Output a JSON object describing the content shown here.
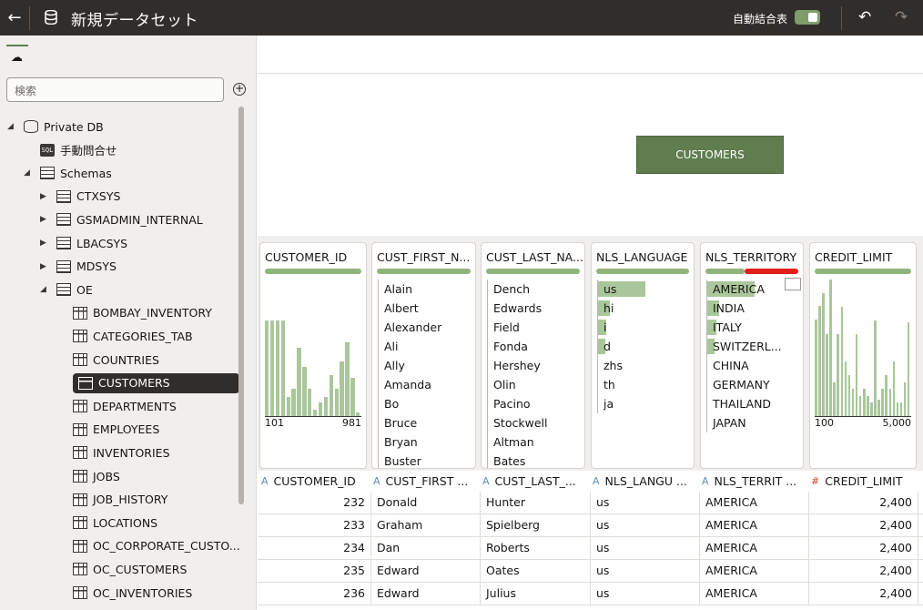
{
  "header": {
    "title": "新規データセット",
    "auto_join_label": "自動結合表",
    "auto_join_on": true
  },
  "sidebar": {
    "search_placeholder": "検索",
    "tree": [
      {
        "label": "Private DB",
        "type": "db",
        "level": 0,
        "expanded": true
      },
      {
        "label": "手動問合せ",
        "type": "sql",
        "level": 1
      },
      {
        "label": "Schemas",
        "type": "schema",
        "level": 1,
        "expanded": true
      },
      {
        "label": "CTXSYS",
        "type": "schema",
        "level": 2,
        "expanded": false
      },
      {
        "label": "GSMADMIN_INTERNAL",
        "type": "schema",
        "level": 2,
        "expanded": false
      },
      {
        "label": "LBACSYS",
        "type": "schema",
        "level": 2,
        "expanded": false
      },
      {
        "label": "MDSYS",
        "type": "schema",
        "level": 2,
        "expanded": false
      },
      {
        "label": "OE",
        "type": "schema",
        "level": 2,
        "expanded": true
      },
      {
        "label": "BOMBAY_INVENTORY",
        "type": "view",
        "level": 3
      },
      {
        "label": "CATEGORIES_TAB",
        "type": "table",
        "level": 3
      },
      {
        "label": "COUNTRIES",
        "type": "view",
        "level": 3
      },
      {
        "label": "CUSTOMERS",
        "type": "table",
        "level": 3,
        "selected": true
      },
      {
        "label": "DEPARTMENTS",
        "type": "view",
        "level": 3
      },
      {
        "label": "EMPLOYEES",
        "type": "view",
        "level": 3
      },
      {
        "label": "INVENTORIES",
        "type": "table",
        "level": 3
      },
      {
        "label": "JOBS",
        "type": "view",
        "level": 3
      },
      {
        "label": "JOB_HISTORY",
        "type": "view",
        "level": 3
      },
      {
        "label": "LOCATIONS",
        "type": "view",
        "level": 3
      },
      {
        "label": "OC_CORPORATE_CUSTO...",
        "type": "view",
        "level": 3
      },
      {
        "label": "OC_CUSTOMERS",
        "type": "view",
        "level": 3
      },
      {
        "label": "OC_INVENTORIES",
        "type": "view",
        "level": 3
      }
    ]
  },
  "diagram": {
    "entity_label": "CUSTOMERS"
  },
  "profile_cards": [
    {
      "title": "CUSTOMER_ID",
      "kind": "histogram",
      "bars": [
        0.7,
        0.7,
        0.7,
        0.7,
        0.14,
        0.2,
        0.5,
        0.36,
        0.2,
        0.05,
        0.1,
        0.14,
        0.3,
        0.2,
        0.4,
        0.54,
        0.28,
        0.03
      ],
      "min_label": "101",
      "max_label": "981",
      "quality": 1.0
    },
    {
      "title": "CUST_FIRST_N...",
      "kind": "list",
      "values": [
        "Alain",
        "Albert",
        "Alexander",
        "Ali",
        "Ally",
        "Amanda",
        "Bo",
        "Bruce",
        "Bryan",
        "Buster"
      ],
      "freq": [
        0,
        0,
        0,
        0,
        0,
        0,
        0,
        0,
        0,
        0
      ],
      "quality": 1.0
    },
    {
      "title": "CUST_LAST_NA...",
      "kind": "list",
      "values": [
        "Dench",
        "Edwards",
        "Field",
        "Fonda",
        "Hershey",
        "Olin",
        "Pacino",
        "Stockwell",
        "Altman",
        "Bates"
      ],
      "freq": [
        0,
        0,
        0,
        0,
        0,
        0,
        0,
        0,
        0,
        0
      ],
      "quality": 1.0
    },
    {
      "title": "NLS_LANGUAGE",
      "kind": "list",
      "values": [
        "us",
        "hi",
        "i",
        "d",
        "zhs",
        "th",
        "ja"
      ],
      "freq": [
        1.0,
        0.25,
        0.18,
        0.16,
        0,
        0,
        0
      ],
      "quality": 1.0
    },
    {
      "title": "NLS_TERRITORY",
      "kind": "list",
      "values": [
        "AMERICA",
        "INDIA",
        "ITALY",
        "SWITZERL...",
        "CHINA",
        "GERMANY",
        "THAILAND",
        "JAPAN"
      ],
      "freq": [
        1.0,
        0.25,
        0.2,
        0.15,
        0,
        0,
        0,
        0
      ],
      "quality": 0.42
    },
    {
      "title": "CREDIT_LIMIT",
      "kind": "histogram",
      "bars": [
        0.71,
        0.81,
        0.9,
        0.6,
        1.0,
        0.25,
        0.6,
        0.8,
        0.4,
        0.3,
        0.2,
        0.6,
        0.15,
        0.2,
        0.15,
        0.1,
        0.7,
        0.12,
        0.2,
        0.3,
        0.2,
        0.4,
        0.1,
        0.1,
        0.25,
        0.69
      ],
      "min_label": "100",
      "max_label": "5,000",
      "quality": 1.0
    }
  ],
  "table": {
    "columns": [
      {
        "type": "A",
        "label": "CUSTOMER_ID"
      },
      {
        "type": "A",
        "label": "CUST_FIRST ..."
      },
      {
        "type": "A",
        "label": "CUST_LAST_..."
      },
      {
        "type": "A",
        "label": "NLS_LANGU ..."
      },
      {
        "type": "A",
        "label": "NLS_TERRIT ..."
      },
      {
        "type": "#",
        "label": "CREDIT_LIMIT"
      }
    ],
    "rows": [
      [
        "232",
        "Donald",
        "Hunter",
        "us",
        "AMERICA",
        "2,400"
      ],
      [
        "233",
        "Graham",
        "Spielberg",
        "us",
        "AMERICA",
        "2,400"
      ],
      [
        "234",
        "Dan",
        "Roberts",
        "us",
        "AMERICA",
        "2,400"
      ],
      [
        "235",
        "Edward",
        "Oates",
        "us",
        "AMERICA",
        "2,400"
      ],
      [
        "236",
        "Edward",
        "Julius",
        "us",
        "AMERICA",
        "2,400"
      ]
    ]
  }
}
